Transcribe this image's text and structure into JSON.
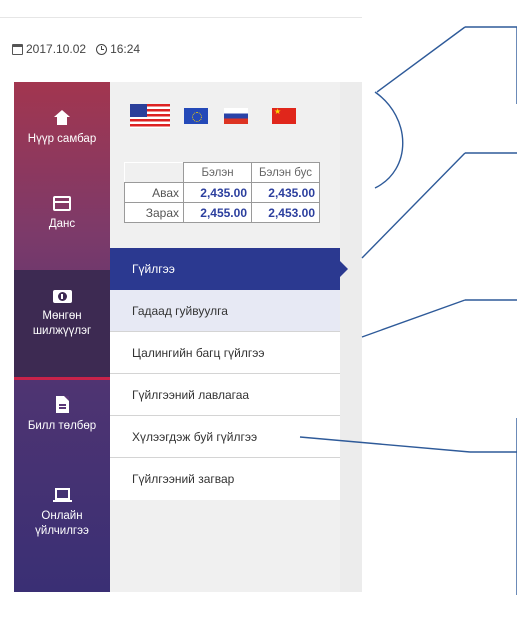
{
  "header": {
    "date": "2017.10.02",
    "time": "16:24",
    "date_icon": "calendar-icon",
    "time_icon": "clock-icon"
  },
  "sidebar": {
    "items": [
      {
        "label": "Нүүр самбар",
        "icon": "home-icon"
      },
      {
        "label": "Данс",
        "icon": "card-icon"
      },
      {
        "label": "Мөнгөн шилжүүлэг",
        "icon": "money-icon",
        "active": true
      },
      {
        "label": "Билл төлбөр",
        "icon": "document-icon"
      },
      {
        "label": "Онлайн үйлчилгээ",
        "icon": "laptop-icon"
      }
    ]
  },
  "currency": {
    "flags": [
      "us-flag",
      "eu-flag",
      "ru-flag",
      "cn-flag"
    ],
    "headers": [
      "Бэлэн",
      "Бэлэн бус"
    ],
    "rows": [
      {
        "label": "Авах",
        "cash": "2,435.00",
        "noncash": "2,435.00"
      },
      {
        "label": "Зарах",
        "cash": "2,455.00",
        "noncash": "2,453.00"
      }
    ]
  },
  "menu": {
    "items": [
      {
        "label": "Гүйлгээ",
        "selected": true
      },
      {
        "label": "Гадаад гуйвуулга"
      },
      {
        "label": "Цалингийн багц гүйлгээ"
      },
      {
        "label": "Гүйлгээний лавлагаа"
      },
      {
        "label": "Хүлээгдэж буй гүйлгээ"
      },
      {
        "label": "Гүйлгээний загвар"
      }
    ]
  },
  "colors": {
    "accent": "#2b3990",
    "active_underline": "#c8234a",
    "rate_value": "#2c3f9e",
    "callout_lines": "#2e5a99"
  }
}
